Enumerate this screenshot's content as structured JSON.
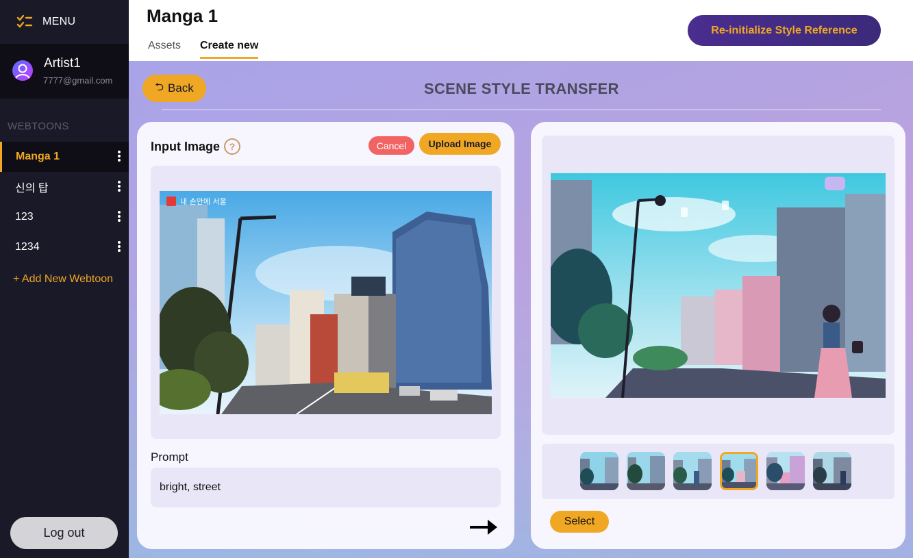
{
  "sidebar": {
    "menu_label": "MENU",
    "user": {
      "name": "Artist1",
      "email": "7777@gmail.com"
    },
    "section_title": "WEBTOONS",
    "items": [
      {
        "label": "Manga 1",
        "active": true
      },
      {
        "label": "신의 탑",
        "active": false
      },
      {
        "label": "123",
        "active": false
      },
      {
        "label": "1234",
        "active": false
      }
    ],
    "add_label": "+ Add New Webtoon",
    "logout_label": "Log out"
  },
  "header": {
    "title": "Manga 1",
    "tabs": [
      {
        "label": "Assets",
        "active": false
      },
      {
        "label": "Create new",
        "active": true
      }
    ],
    "reinit_label": "Re-initialize Style Reference"
  },
  "main": {
    "back_label": "Back",
    "scene_title": "SCENE STYLE TRANSFER",
    "input": {
      "label": "Input Image",
      "help_symbol": "?",
      "cancel_label": "Cancel",
      "upload_label": "Upload Image",
      "image_watermark": "내 손안에 서울",
      "prompt_label": "Prompt",
      "prompt_value": "bright, street"
    },
    "output": {
      "thumbnail_count": 6,
      "selected_thumbnail": 4,
      "select_label": "Select"
    }
  },
  "colors": {
    "accent": "#f0a824",
    "sidebar_bg": "#1a1928",
    "cancel": "#f26363",
    "reinit_bg": "#4a2d8f"
  }
}
